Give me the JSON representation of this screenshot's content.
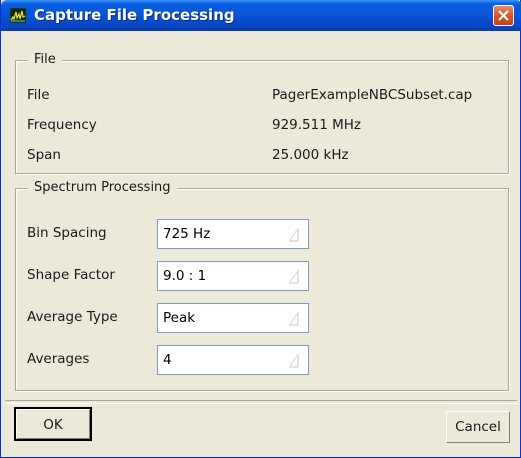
{
  "window": {
    "title": "Capture File Processing",
    "icon": "spectrum-app-icon",
    "close_icon": "close-icon"
  },
  "file_group": {
    "legend": "File",
    "rows": [
      {
        "label": "File",
        "value": "PagerExampleNBCSubset.cap"
      },
      {
        "label": "Frequency",
        "value": "929.511 MHz"
      },
      {
        "label": "Span",
        "value": "25.000 kHz"
      }
    ]
  },
  "spectrum_group": {
    "legend": "Spectrum Processing",
    "fields": [
      {
        "label": "Bin Spacing",
        "value": "725 Hz"
      },
      {
        "label": "Shape Factor",
        "value": "9.0 : 1"
      },
      {
        "label": "Average Type",
        "value": "Peak"
      },
      {
        "label": "Averages",
        "value": "4"
      }
    ]
  },
  "buttons": {
    "ok": "OK",
    "cancel": "Cancel"
  },
  "colors": {
    "titlebar": "#0853d6",
    "dialog_bg": "#ece9d8",
    "close_button": "#d4572c"
  }
}
